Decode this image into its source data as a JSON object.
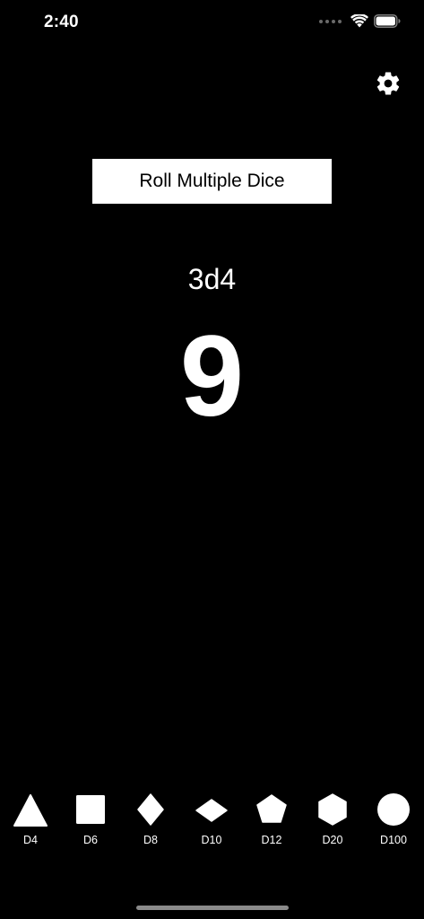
{
  "status_bar": {
    "time": "2:40",
    "icons": [
      "cellular-dots-icon",
      "wifi-icon",
      "battery-icon"
    ]
  },
  "toolbar": {
    "settings_icon": "gear-icon"
  },
  "roll_multiple_button": {
    "label": "Roll Multiple Dice"
  },
  "result": {
    "notation": "3d4",
    "total": "9"
  },
  "dice": [
    {
      "label": "D4",
      "icon": "triangle-icon"
    },
    {
      "label": "D6",
      "icon": "square-icon"
    },
    {
      "label": "D8",
      "icon": "diamond-icon"
    },
    {
      "label": "D10",
      "icon": "kite-icon"
    },
    {
      "label": "D12",
      "icon": "pentagon-icon"
    },
    {
      "label": "D20",
      "icon": "hexagon-icon"
    },
    {
      "label": "D100",
      "icon": "circle-icon"
    }
  ],
  "colors": {
    "background": "#000000",
    "foreground": "#ffffff",
    "button_text": "#000000"
  }
}
